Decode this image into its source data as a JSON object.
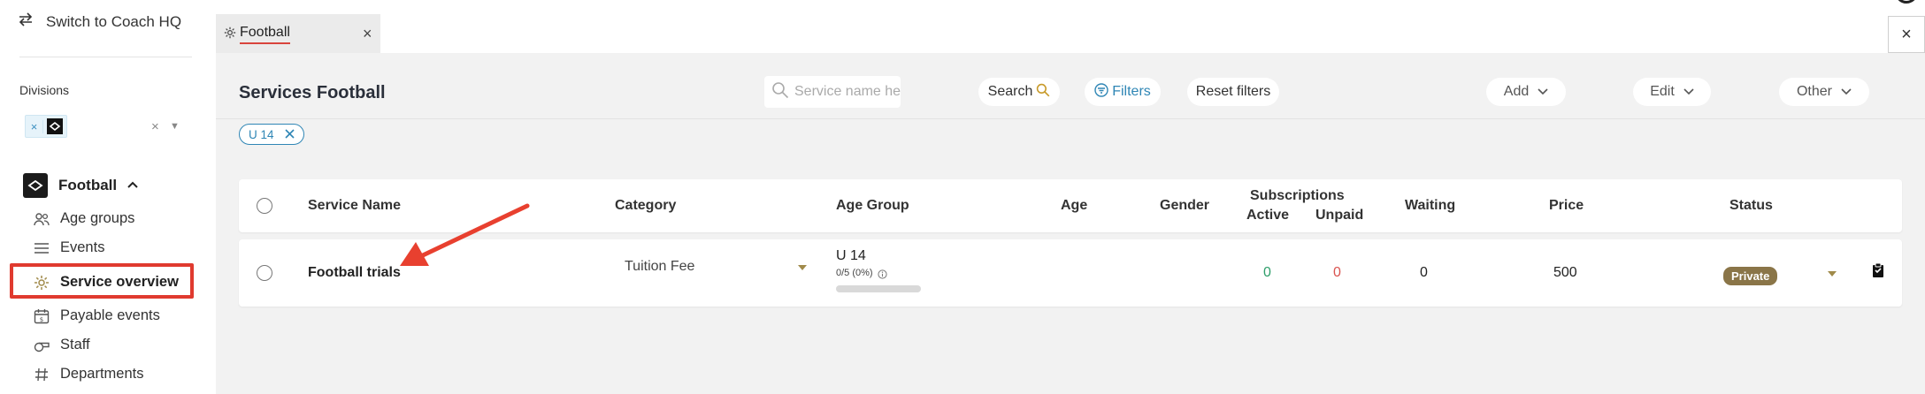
{
  "sidebar": {
    "switch_label": "Switch to Coach HQ",
    "divisions_label": "Divisions",
    "division_chip_remove": "×",
    "clear_glyph": "×",
    "sport_label": "Football",
    "items": [
      {
        "label": "Age groups",
        "icon": "users-icon"
      },
      {
        "label": "Events",
        "icon": "list-icon"
      },
      {
        "label": "Service overview",
        "icon": "gear-icon",
        "active": true
      },
      {
        "label": "Payable events",
        "icon": "calendar-dollar-icon"
      },
      {
        "label": "Staff",
        "icon": "whistle-icon"
      },
      {
        "label": "Departments",
        "icon": "hash-icon"
      }
    ]
  },
  "tabs": {
    "active_tab": "Football",
    "close_glyph": "×",
    "window_close_glyph": "×"
  },
  "main": {
    "title": "Services Football",
    "search_placeholder": "Service name here",
    "search_button": "Search",
    "filters_button": "Filters",
    "reset_button": "Reset filters",
    "add_dropdown": "Add",
    "edit_dropdown": "Edit",
    "other_dropdown": "Other",
    "active_filter_chip": "U 14"
  },
  "table": {
    "headers": {
      "service_name": "Service Name",
      "category": "Category",
      "age_group": "Age Group",
      "age": "Age",
      "gender": "Gender",
      "subscriptions": "Subscriptions",
      "active": "Active",
      "unpaid": "Unpaid",
      "waiting": "Waiting",
      "price": "Price",
      "status": "Status"
    },
    "rows": [
      {
        "service_name": "Football trials",
        "category": "Tuition Fee",
        "age_group": "U 14",
        "capacity": "0/5 (0%)",
        "capacity_fraction": 0,
        "age": "",
        "gender": "",
        "active": "0",
        "unpaid": "0",
        "waiting": "0",
        "price": "500",
        "status": "Private"
      }
    ]
  },
  "colors": {
    "highlight": "#e03a2f",
    "accent": "#2f86b5",
    "active_count": "#2e9e6a",
    "unpaid_count": "#d9534f",
    "status_badge": "#8a7548"
  }
}
